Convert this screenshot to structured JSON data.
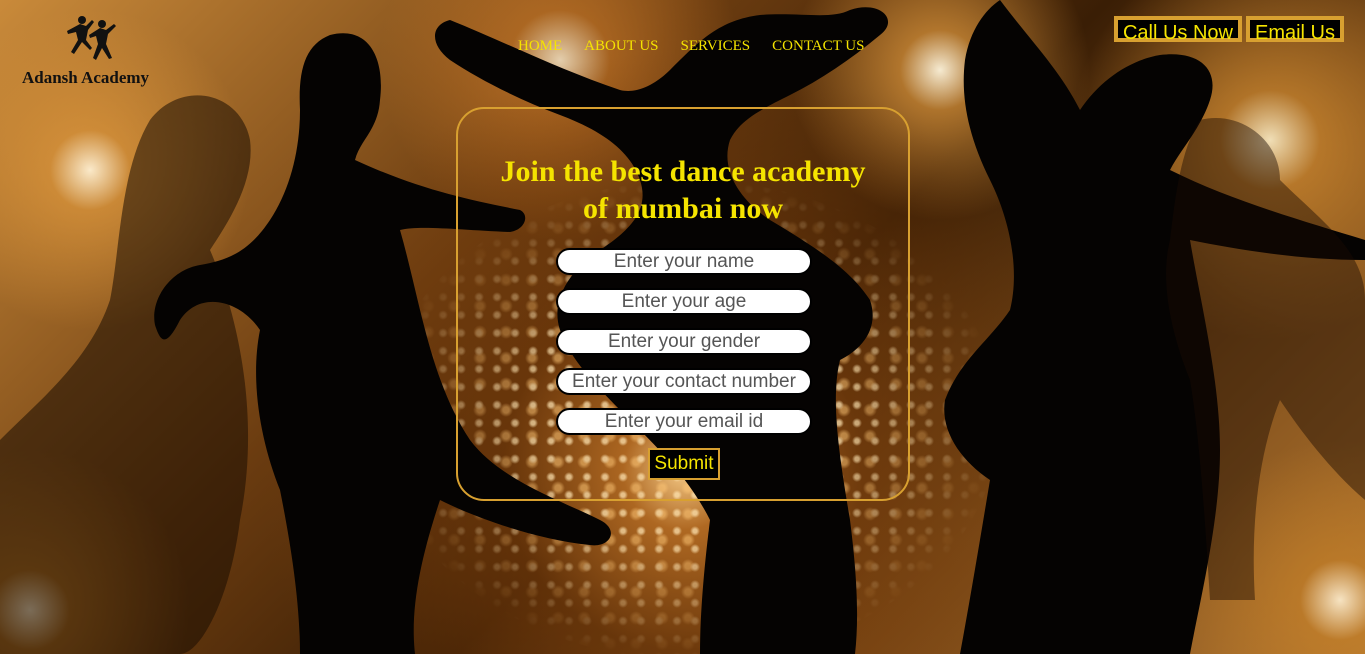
{
  "logo": {
    "icon": "dancers-logo-icon",
    "text": "Adansh Academy"
  },
  "nav": {
    "items": [
      {
        "label": "HOME"
      },
      {
        "label": "ABOUT US"
      },
      {
        "label": "SERVICES"
      },
      {
        "label": "CONTACT US"
      }
    ]
  },
  "header_buttons": {
    "call": "Call Us Now",
    "email": "Email Us"
  },
  "form": {
    "title_line1": "Join the best dance academy",
    "title_line2": "of mumbai now",
    "name_placeholder": "Enter your name",
    "age_placeholder": "Enter your age",
    "gender_placeholder": "Enter your gender",
    "contact_placeholder": "Enter your contact number",
    "email_placeholder": "Enter your email id",
    "submit_label": "Submit"
  },
  "colors": {
    "accent_text": "#f5e400",
    "border_gold": "#d8a030",
    "background": "#000000"
  }
}
